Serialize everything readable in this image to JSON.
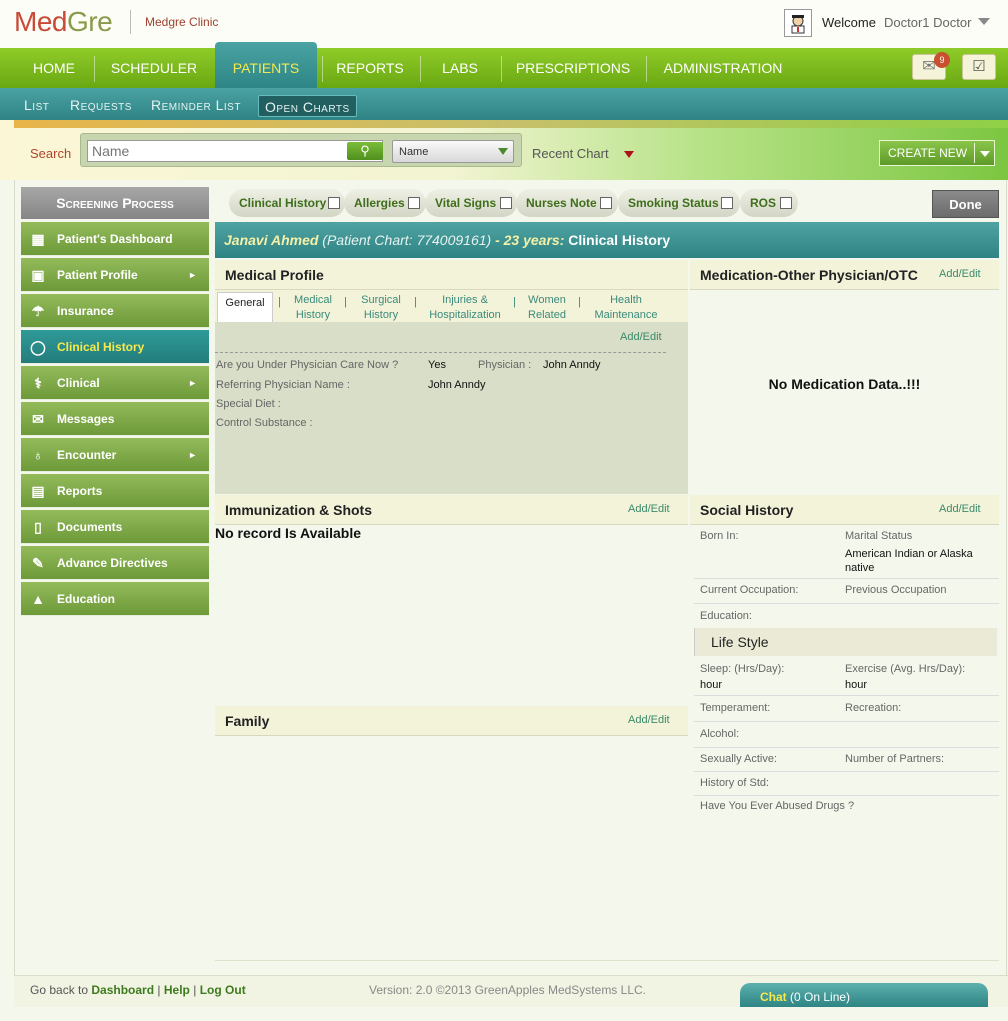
{
  "app": {
    "logo_med": "Med",
    "logo_gre": "Gre",
    "clinic": "Medgre Clinic",
    "welcome": "Welcome",
    "user": "Doctor1 Doctor"
  },
  "nav": {
    "items": [
      "HOME",
      "SCHEDULER",
      "PATIENTS",
      "REPORTS",
      "LABS",
      "PRESCRIPTIONS",
      "ADMINISTRATION"
    ],
    "active": "PATIENTS",
    "mail_count": "9"
  },
  "subnav": {
    "items": [
      "List",
      "Requests",
      "Reminder List",
      "Open Charts"
    ],
    "active": "Open Charts"
  },
  "search": {
    "label": "Search",
    "placeholder": "Name",
    "select_value": "Name",
    "recent": "Recent Chart",
    "create": "CREATE NEW"
  },
  "sidebar": {
    "title": "Screening Process",
    "items": [
      {
        "label": "Patient's Dashboard",
        "icon": "dashboard-icon",
        "arrow": false
      },
      {
        "label": "Patient Profile",
        "icon": "image-icon",
        "arrow": true
      },
      {
        "label": "Insurance",
        "icon": "umbrella-icon",
        "arrow": false
      },
      {
        "label": "Clinical History",
        "icon": "circle-icon",
        "arrow": false
      },
      {
        "label": "Clinical",
        "icon": "caduceus-icon",
        "arrow": true
      },
      {
        "label": "Messages",
        "icon": "envelope-icon",
        "arrow": false
      },
      {
        "label": "Encounter",
        "icon": "stethoscope-icon",
        "arrow": true
      },
      {
        "label": "Reports",
        "icon": "document-icon",
        "arrow": false
      },
      {
        "label": "Documents",
        "icon": "page-icon",
        "arrow": false
      },
      {
        "label": "Advance Directives",
        "icon": "pen-paper-icon",
        "arrow": false
      },
      {
        "label": "Education",
        "icon": "graduation-cap-icon",
        "arrow": false
      }
    ],
    "active": "Clinical History"
  },
  "tabs": {
    "items": [
      "Clinical History",
      "Allergies",
      "Vital Signs",
      "Nurses Note",
      "Smoking Status",
      "ROS"
    ],
    "done": "Done"
  },
  "patient": {
    "name": "Janavi Ahmed",
    "chart": "(Patient Chart: 774009161)",
    "dash": "-",
    "age": "23 years:",
    "section": "Clinical History"
  },
  "medical_profile": {
    "title": "Medical Profile",
    "add_edit": "Add/Edit",
    "tabs": [
      "General",
      "Medical History",
      "Surgical History",
      "Injuries & Hospitalization",
      "Women Related",
      "Health Maintenance"
    ],
    "fields": {
      "under_care_label": "Are you Under Physician Care Now ?",
      "under_care_value": "Yes",
      "physician_label": "Physician :",
      "physician_value": "John Anndy",
      "referring_label": "Referring Physician Name :",
      "referring_value": "John Anndy",
      "diet_label": "Special Diet :",
      "control_label": "Control Substance :"
    }
  },
  "medication": {
    "title": "Medication-Other Physician/OTC",
    "add_edit": "Add/Edit",
    "empty": "No Medication Data..!!!"
  },
  "immunization": {
    "title": "Immunization & Shots",
    "add_edit": "Add/Edit",
    "empty": "No record Is Available"
  },
  "family": {
    "title": "Family",
    "add_edit": "Add/Edit"
  },
  "social": {
    "title": "Social History",
    "add_edit": "Add/Edit",
    "born_in": "Born In:",
    "marital_label": "Marital Status",
    "marital_value": "American Indian or Alaska native",
    "current_occ": "Current Occupation:",
    "previous_occ": "Previous Occupation",
    "education": "Education:",
    "lifestyle": "Life Style",
    "sleep_label": "Sleep: (Hrs/Day):",
    "sleep_value": "hour",
    "exercise_label": "Exercise (Avg. Hrs/Day):",
    "exercise_value": "hour",
    "temperament": "Temperament:",
    "recreation": "Recreation:",
    "alcohol": "Alcohol:",
    "sexually_active": "Sexually Active:",
    "partners": "Number of Partners:",
    "std": "History of Std:",
    "drugs": "Have You Ever Abused Drugs ?"
  },
  "footer": {
    "go_back": "Go back to",
    "dashboard": "Dashboard",
    "help": "Help",
    "logout": "Log Out",
    "sep": "|",
    "version": "Version: 2.0 ©2013 GreenApples MedSystems LLC.",
    "chat": "Chat",
    "chat_status": "(0 On Line)"
  },
  "colors": {
    "nav_green": "#7dbb1e",
    "teal": "#2f8585",
    "active_text": "#f5e94a"
  }
}
